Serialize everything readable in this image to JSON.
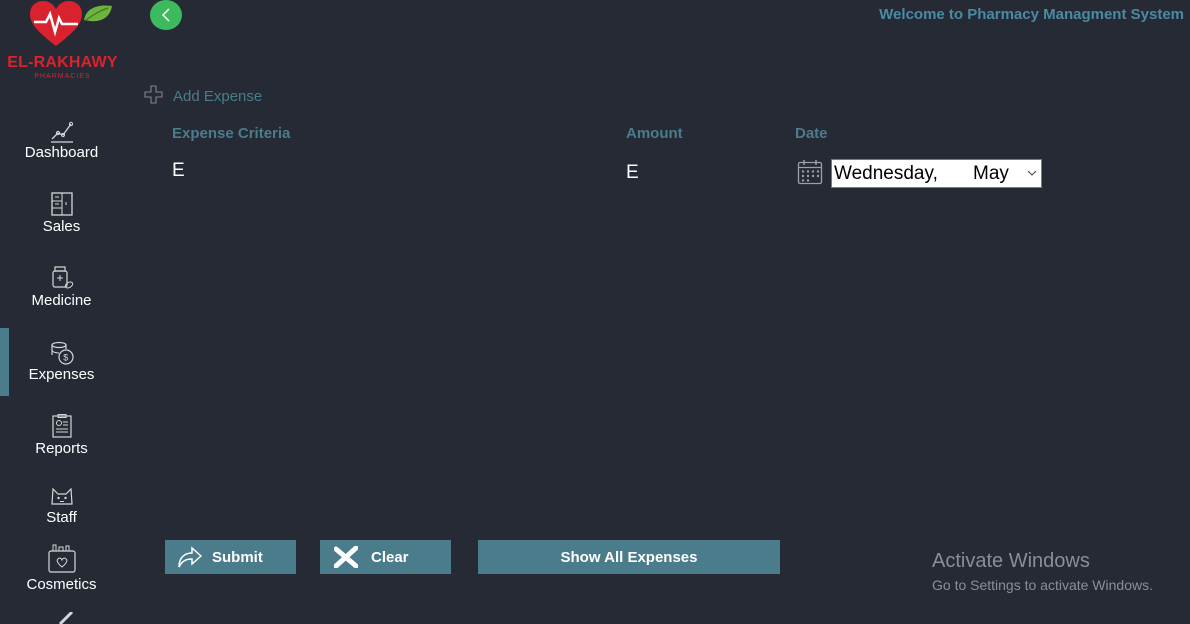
{
  "app": {
    "brand": "EL-RAKHAWY",
    "brand_sub": "PHARMACIES",
    "welcome": "Welcome to Pharmacy Managment System"
  },
  "sidebar": {
    "items": [
      {
        "label": "Dashboard",
        "icon": "chart-line-icon"
      },
      {
        "label": "Sales",
        "icon": "cabinet-icon"
      },
      {
        "label": "Medicine",
        "icon": "medicine-bottle-icon"
      },
      {
        "label": "Expenses",
        "icon": "coins-icon",
        "active": true
      },
      {
        "label": "Reports",
        "icon": "report-clipboard-icon"
      },
      {
        "label": "Staff",
        "icon": "staff-cat-icon"
      },
      {
        "label": "Cosmetics",
        "icon": "cosmetics-bag-icon"
      }
    ]
  },
  "form": {
    "add_label": "Add Expense",
    "criteria_label": "Expense Criteria",
    "criteria_value": "E",
    "amount_label": "Amount",
    "amount_value": "E",
    "date_label": "Date",
    "date_value_day": "Wednesday,",
    "date_value_month": "May"
  },
  "buttons": {
    "submit": "Submit",
    "clear": "Clear",
    "show_all": "Show All Expenses"
  },
  "watermark": {
    "title": "Activate Windows",
    "subtitle": "Go to Settings to activate Windows."
  },
  "colors": {
    "background": "#262a34",
    "accent": "#4a7c8c",
    "brand_red": "#d8232f",
    "back_green": "#3dba5e"
  }
}
